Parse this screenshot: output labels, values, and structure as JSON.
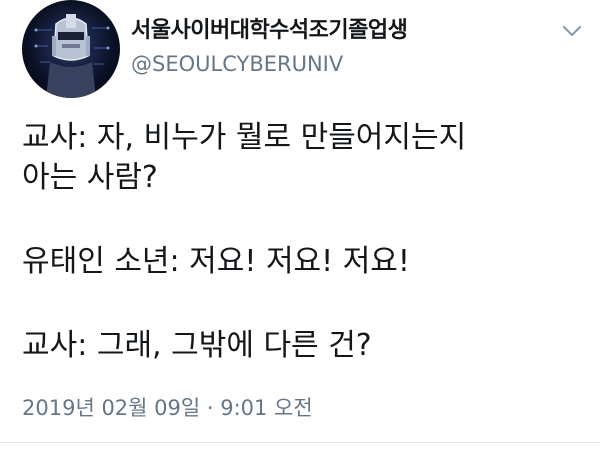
{
  "user": {
    "display_name": "서울사이버대학수석조기졸업생",
    "handle": "@SEOULCYBERUNIV"
  },
  "tweet": {
    "lines": [
      "교사: 자, 비누가 뭘로 만들어지는지",
      "아는 사람?",
      "유태인 소년: 저요! 저요! 저요!",
      "교사: 그래, 그밖에 다른 건?"
    ],
    "timestamp": "2019년 02월 09일 · 9:01 오전"
  },
  "icons": {
    "menu": "chevron-down-icon",
    "avatar": "robot-helmet-avatar"
  },
  "colors": {
    "text": "#14171a",
    "secondary": "#657786",
    "divider": "#e1e8ed"
  }
}
